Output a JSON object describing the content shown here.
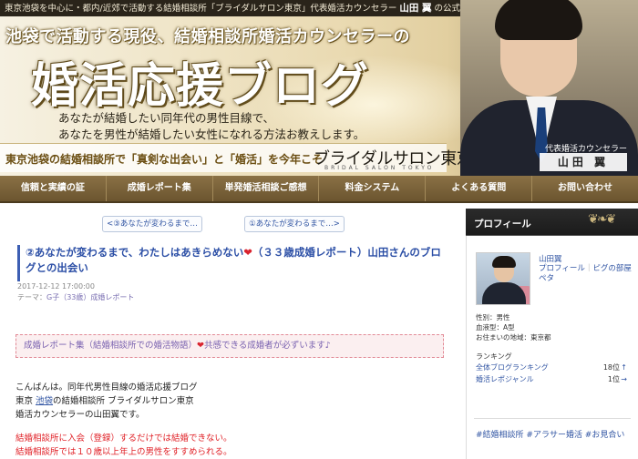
{
  "header": {
    "top_line_prefix": "東京池袋を中心に・都内/近郊で活動する結婚相談所「ブライダルサロン東京」代表婚活カウンセラー",
    "top_line_name": "山田 翼",
    "top_line_suffix": "の公式ブログです。",
    "catch_copy": "池袋で活動する現役、結婚相談所婚活カウンセラーの",
    "blog_title": "婚活応援ブログ",
    "description_line1": "あなたが結婚したい同年代の男性目線で、",
    "description_line2": "あなたを男性が結婚したい女性になれる方法お教えします。",
    "sub_tagline": "東京池袋の結婚相談所で「真剣な出会い」と「婚活」を今年こそ",
    "brand_name": "ブライダルサロン東京",
    "brand_sub": "BRIDAL SALON TOKYO",
    "person_role": "代表婚活カウンセラー",
    "person_name": "山田 翼"
  },
  "nav": {
    "items": [
      "信頼と実績の証",
      "成婚レポート集",
      "単発婚活相談ご感想",
      "料金システム",
      "よくある質問",
      "お問い合わせ"
    ]
  },
  "pager": {
    "prev_label": "<③あなたが変わるまで…",
    "next_label": "①あなたが変わるまで…>"
  },
  "article": {
    "title_part1": "②あなたが変わるまで、わたしはあきらめない",
    "title_heart": "❤",
    "title_part2": "（３３歳成婚レポート）山田さんのブログとの出会い",
    "date": "2017-12-12 17:00:00",
    "theme_prefix": "テーマ：",
    "theme_value": "G子（33歳）成婚レポート",
    "report_box_part1": "成婚レポート集（結婚相談所での婚活物語）",
    "report_box_heart": "❤",
    "report_box_part2": "共感できる成婚者が必ずいます♪",
    "paragraph1_line1": "こんばんは。同年代男性目線の婚活応援ブログ",
    "paragraph1_line2_prefix": "東京 ",
    "paragraph1_line2_link": "池袋",
    "paragraph1_line2_suffix": "の結婚相談所 ブライダルサロン東京",
    "paragraph1_line3": "婚活カウンセラーの山田翼です。",
    "paragraph2_line1": "結婚相談所に入会（登録）するだけでは結婚できない。",
    "paragraph2_line2": "結婚相談所では１０歳以上年上の男性をすすめられる。"
  },
  "sidebar": {
    "heading": "プロフィール",
    "ornament": "❦❧❦",
    "name": "山田翼",
    "link_profile": "プロフィール",
    "link_separator": "｜",
    "link_pigg": "ピグの部屋",
    "link_pedu": "ペタ",
    "gender": "性別：男性",
    "blood_type": "血液型：A型",
    "location": "お住まいの地域：東京都",
    "ranking_label": "ランキング",
    "rank1_name": "全体ブログランキング",
    "rank1_value": "18位",
    "rank1_arrow": "↑",
    "rank2_name": "婚活レポジャンル",
    "rank2_value": "1位",
    "rank2_arrow": "→",
    "tags_text": "#結婚相談所 #アラサー婚活 #お見合い"
  },
  "colors": {
    "nav_bg": "#7a6239",
    "link_blue": "#3155a3",
    "title_blue": "#2c4fa6",
    "red_text": "#e01f25",
    "report_box_bg": "#fbeff0",
    "sidebar_head_bg": "#222222"
  }
}
